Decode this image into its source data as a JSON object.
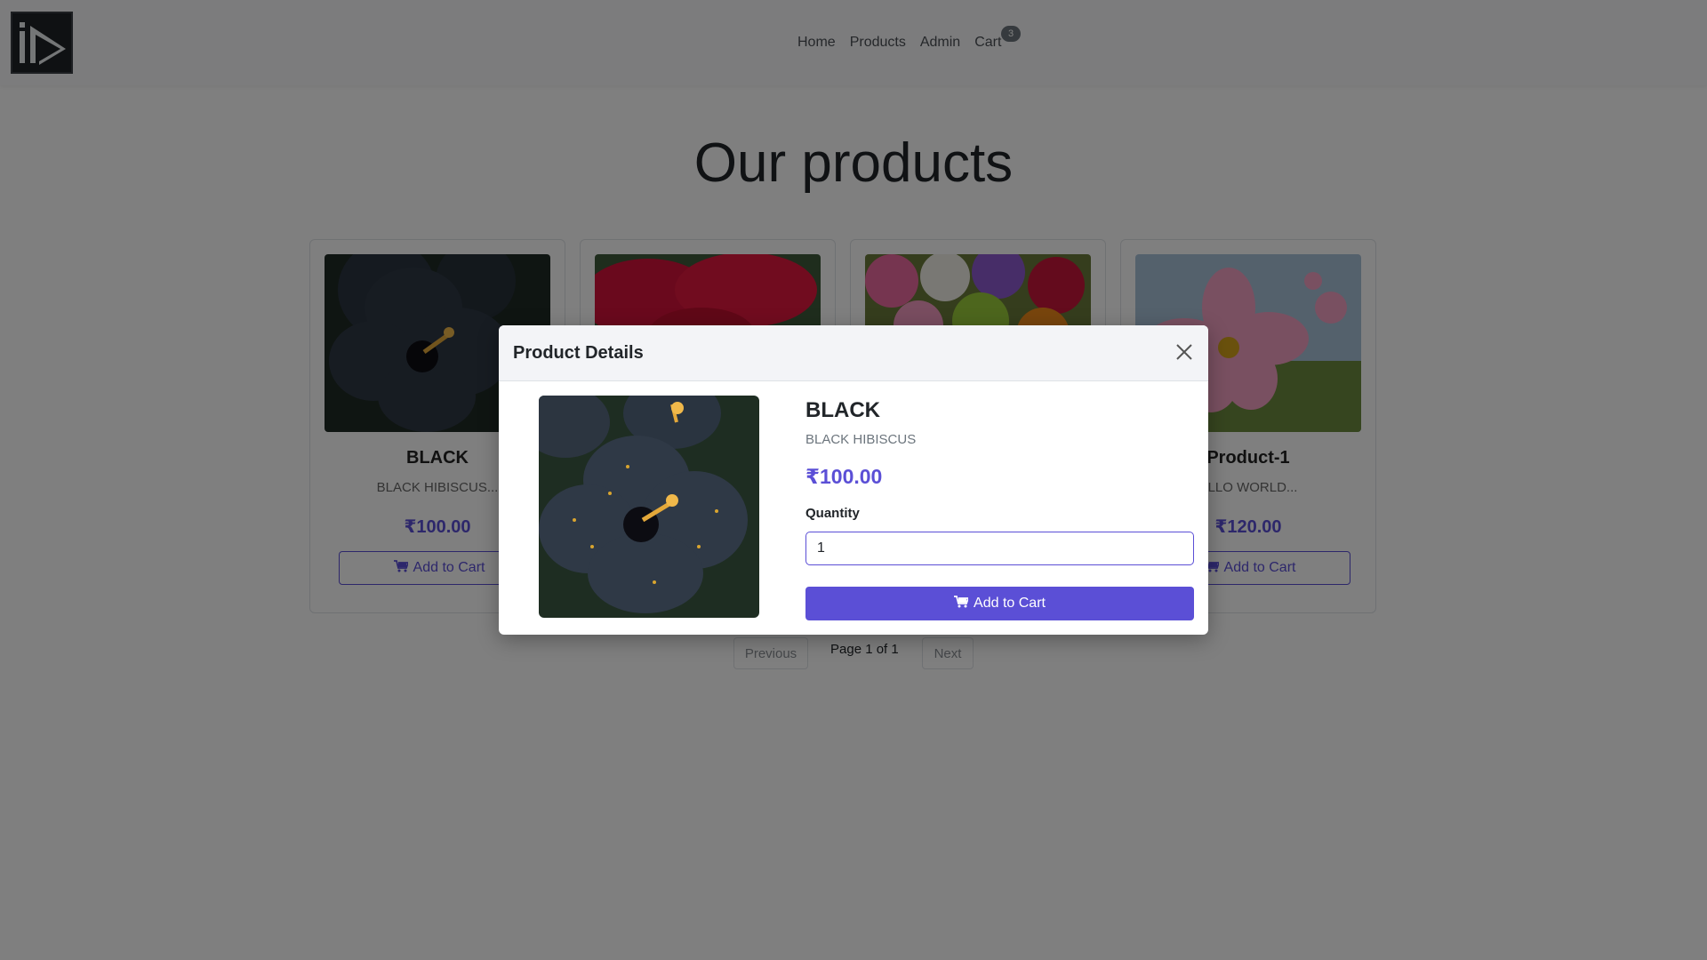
{
  "nav": {
    "links": [
      "Home",
      "Products",
      "Admin",
      "Cart"
    ],
    "cart_count": "3"
  },
  "page": {
    "title": "Our products"
  },
  "products": [
    {
      "name": "BLACK",
      "desc": "BLACK HIBISCUS...",
      "price": "₹100.00",
      "button": "Add to Cart"
    },
    {
      "name": "",
      "desc": "",
      "price": "",
      "button": ""
    },
    {
      "name": "",
      "desc": "",
      "price": "",
      "button": ""
    },
    {
      "name": "Product-1",
      "desc": "ELLO WORLD...",
      "price": "₹120.00",
      "button": "Add to Cart"
    }
  ],
  "pagination": {
    "previous": "Previous",
    "status": "Page 1 of 1",
    "next": "Next"
  },
  "modal": {
    "title": "Product Details",
    "name": "BLACK",
    "desc": "BLACK HIBISCUS",
    "price": "₹100.00",
    "quantity_label": "Quantity",
    "quantity_value": "1",
    "add_button": "Add to Cart"
  },
  "colors": {
    "accent": "#5b4fd6",
    "overlay": "rgba(0,0,0,0.5)"
  }
}
